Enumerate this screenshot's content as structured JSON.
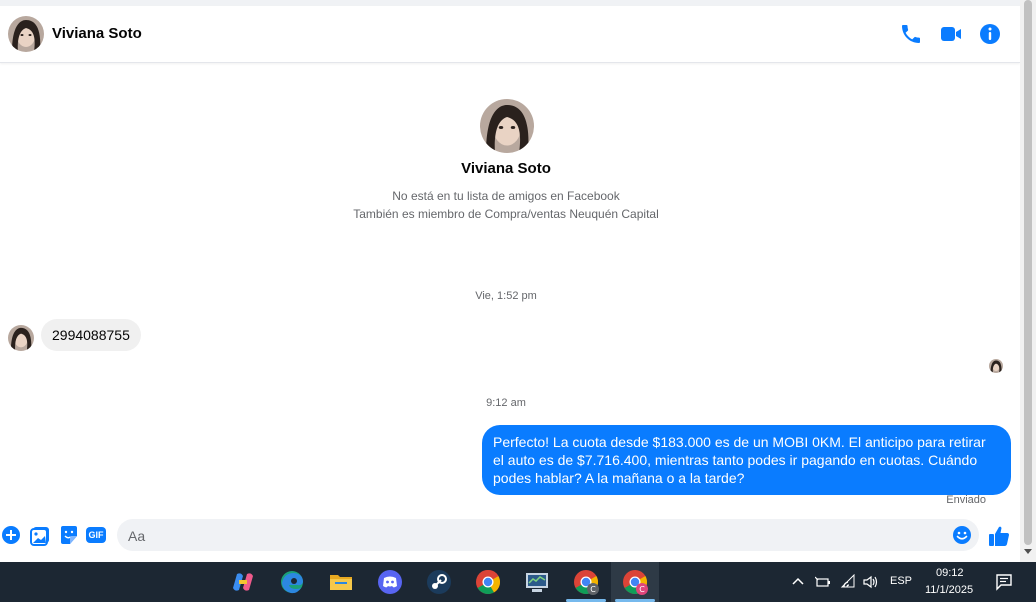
{
  "header": {
    "contact_name": "Viviana Soto",
    "icons": [
      "phone-icon",
      "video-icon",
      "info-icon"
    ]
  },
  "profile": {
    "name": "Viviana Soto",
    "line1": "No está en tu lista de amigos en Facebook",
    "line2": "También es miembro de Compra/ventas Neuquén Capital"
  },
  "conversation": {
    "timestamp1": "Vie, 1:52 pm",
    "incoming_message": "2994088755",
    "timestamp2": "9:12 am",
    "outgoing_message": "Perfecto! La cuota desde $183.000 es de un MOBI 0KM. El anticipo para retirar el auto es de $7.716.400, mientras tanto podes ir pagando en cuotas. Cuándo podes hablar? A la mañana o a la tarde?",
    "status": "Enviado"
  },
  "composer": {
    "placeholder": "Aa",
    "icons": [
      "plus-icon",
      "image-icon",
      "sticker-icon",
      "gif-icon",
      "emoji-icon",
      "like-icon"
    ],
    "gif_label": "GIF"
  },
  "taskbar": {
    "apps": [
      "copilot-icon",
      "edge-icon",
      "file-explorer-icon",
      "discord-icon",
      "steam-icon",
      "chrome-icon",
      "network-monitor-icon",
      "chrome-profile-c-icon",
      "chrome-profile-c-active-icon"
    ],
    "language": "ESP",
    "time": "09:12",
    "date": "11/1/2025"
  },
  "colors": {
    "accent": "#0a7cff",
    "taskbar": "#1c2733"
  }
}
